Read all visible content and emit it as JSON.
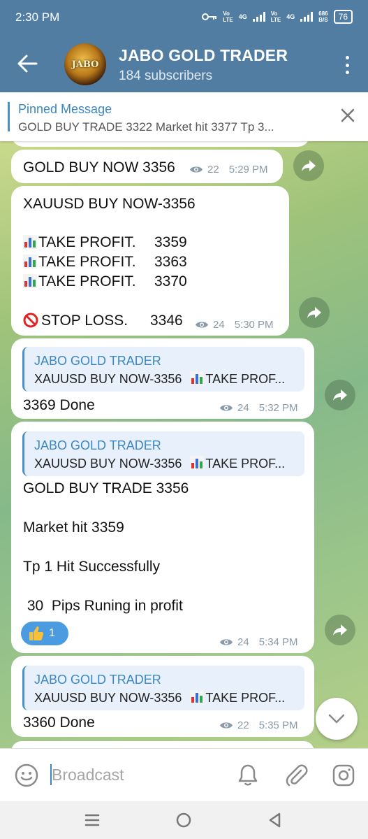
{
  "status_bar": {
    "time": "2:30 PM",
    "sim1_top": "Vo",
    "sim1_bottom": "LTE",
    "sim1_net": "4G",
    "sim2_top": "Vo",
    "sim2_bottom": "LTE",
    "sim2_net": "4G",
    "speed_top": "686",
    "speed_bottom": "B/S",
    "battery": "76"
  },
  "header": {
    "avatar_text": "JABO",
    "title": "JABO GOLD TRADER",
    "subtitle": "184 subscribers"
  },
  "pinned": {
    "title": "Pinned Message",
    "text": "GOLD BUY TRADE 3322  Market hit 3377  Tp 3..."
  },
  "messages": [
    {
      "text": "GOLD BUY NOW 3356",
      "views": "22",
      "time": "5:29 PM"
    },
    {
      "line1": "XAUUSD BUY NOW-3356",
      "tp1_label": "TAKE PROFIT.",
      "tp1_value": "3359",
      "tp2_label": "TAKE PROFIT.",
      "tp2_value": "3363",
      "tp3_label": "TAKE PROFIT.",
      "tp3_value": "3370",
      "sl_label": "STOP LOSS.",
      "sl_value": "3346",
      "views": "24",
      "time": "5:30 PM"
    },
    {
      "reply_name": "JABO GOLD TRADER",
      "reply_text_a": "XAUUSD BUY NOW-3356",
      "reply_text_b": "TAKE PROF...",
      "text": "3369 Done",
      "views": "24",
      "time": "5:32 PM"
    },
    {
      "reply_name": "JABO GOLD TRADER",
      "reply_text_a": "XAUUSD BUY NOW-3356",
      "reply_text_b": "TAKE PROF...",
      "line1": "GOLD BUY TRADE 3356",
      "line2": "Market hit 3359",
      "line3": "Tp 1 Hit Successfully",
      "line4": " 30  Pips Runing in profit",
      "reaction_count": "1",
      "views": "24",
      "time": "5:34 PM"
    },
    {
      "reply_name": "JABO GOLD TRADER",
      "reply_text_a": "XAUUSD BUY NOW-3356",
      "reply_text_b": "TAKE PROF...",
      "text": "3360 Done",
      "views": "22",
      "time": "5:35 PM"
    }
  ],
  "input": {
    "placeholder": "Broadcast"
  },
  "colors": {
    "header": "#527da3",
    "accent": "#3b87c4",
    "reaction": "#4a9be0"
  }
}
